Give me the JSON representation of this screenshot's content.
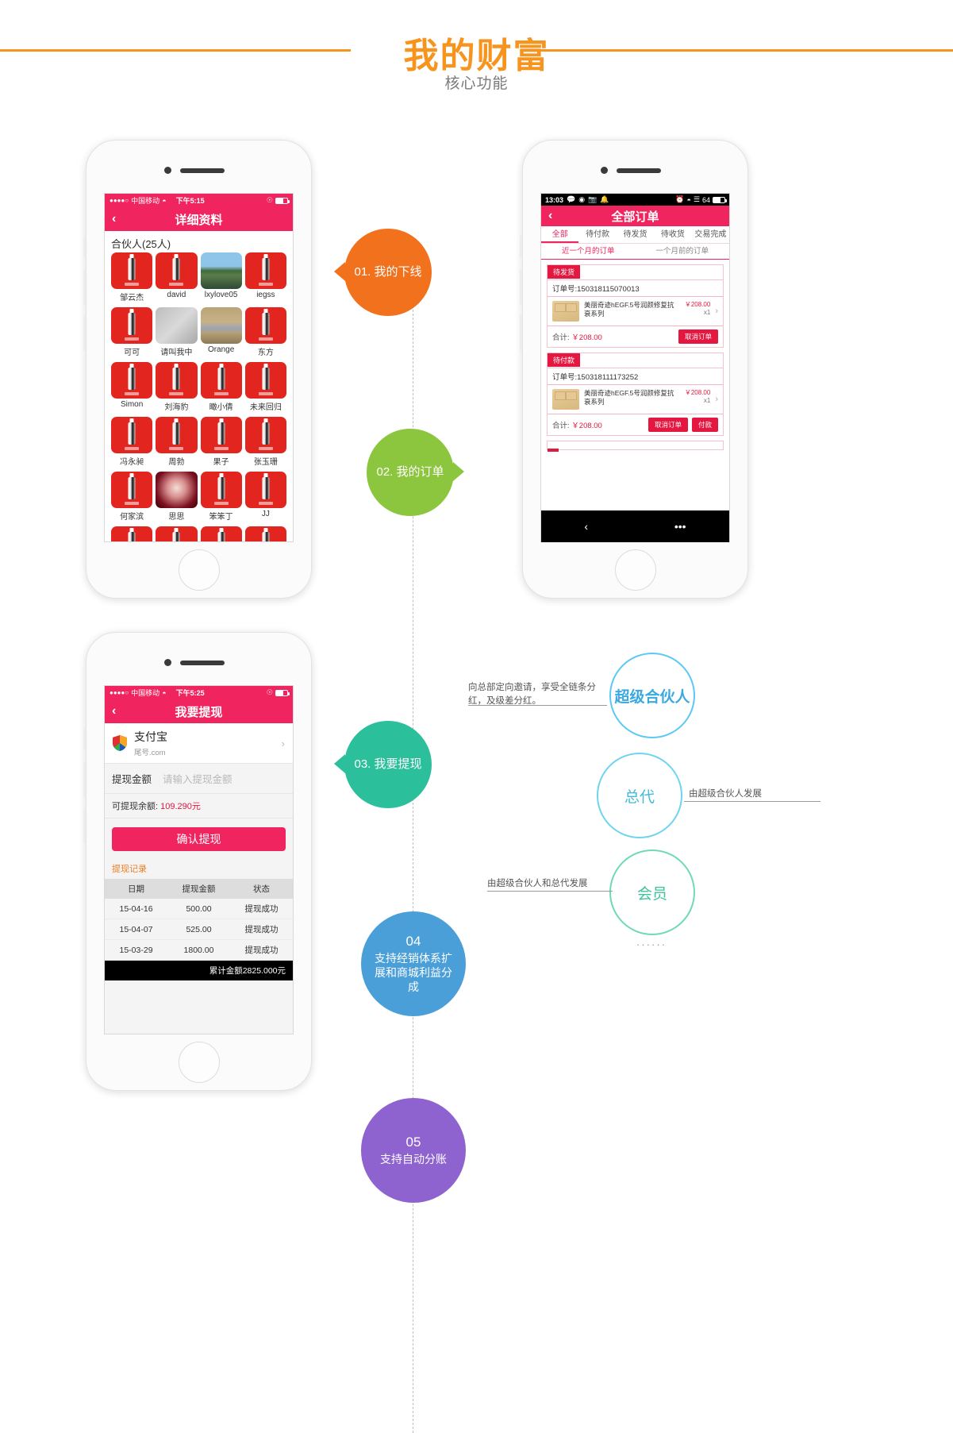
{
  "header": {
    "title": "我的财富",
    "subtitle": "核心功能"
  },
  "phone1": {
    "status": {
      "carrier": "中国移动",
      "dots": "●●●●○",
      "wifi": "ᵛ",
      "time": "下午5:15"
    },
    "nav": {
      "back": "‹",
      "title": "详细资料"
    },
    "section_title": "合伙人(25人)",
    "partners": [
      {
        "name": "邹云杰",
        "avatar": "product"
      },
      {
        "name": "david",
        "avatar": "product"
      },
      {
        "name": "lxylove05",
        "avatar": "photo-a"
      },
      {
        "name": "iegss",
        "avatar": "product"
      },
      {
        "name": "可可",
        "avatar": "product"
      },
      {
        "name": "请叫我中",
        "avatar": "photo-b"
      },
      {
        "name": "Orange",
        "avatar": "photo-c"
      },
      {
        "name": "东方",
        "avatar": "product"
      },
      {
        "name": "Simon",
        "avatar": "product"
      },
      {
        "name": "刘海豹",
        "avatar": "product"
      },
      {
        "name": "瞰小倩",
        "avatar": "product"
      },
      {
        "name": "未来回归",
        "avatar": "product"
      },
      {
        "name": "冯永昶",
        "avatar": "product"
      },
      {
        "name": "周勃",
        "avatar": "product"
      },
      {
        "name": "果子",
        "avatar": "product"
      },
      {
        "name": "张玉珊",
        "avatar": "product"
      },
      {
        "name": "何家滨",
        "avatar": "product"
      },
      {
        "name": "思思",
        "avatar": "photo-d"
      },
      {
        "name": "笨笨丁",
        "avatar": "product"
      },
      {
        "name": "JJ",
        "avatar": "product"
      },
      {
        "name": "",
        "avatar": "product"
      },
      {
        "name": "",
        "avatar": "product"
      },
      {
        "name": "",
        "avatar": "product"
      },
      {
        "name": "",
        "avatar": "product"
      }
    ]
  },
  "phone2": {
    "status": {
      "time": "13:03",
      "icons": [
        "message-icon",
        "link-icon",
        "photo-icon",
        "bell-icon"
      ],
      "right_icons": [
        "alarm-icon",
        "wifi-icon",
        "signal-icon"
      ],
      "battery": "64"
    },
    "nav": {
      "back": "‹",
      "title": "全部订单"
    },
    "tabs": [
      {
        "label": "全部",
        "active": true
      },
      {
        "label": "待付款",
        "active": false
      },
      {
        "label": "待发货",
        "active": false
      },
      {
        "label": "待收货",
        "active": false
      },
      {
        "label": "交易完成",
        "active": false
      }
    ],
    "subtabs": [
      {
        "label": "近一个月的订单",
        "active": true
      },
      {
        "label": "一个月前的订单",
        "active": false
      }
    ],
    "orders": [
      {
        "status_tag": "待发货",
        "order_no_label": "订单号:150318115070013",
        "product_name": "美丽奇迹hEGF.5号润颜修复抗衰系列",
        "price": "￥208.00",
        "qty": "x1",
        "arrow": "›",
        "total_label": "合计:",
        "total_amount": "￥208.00",
        "buttons": [
          "取消订单"
        ]
      },
      {
        "status_tag": "待付款",
        "order_no_label": "订单号:150318111173252",
        "product_name": "美丽奇迹hEGF.5号润颜修复抗衰系列",
        "price": "￥208.00",
        "qty": "x1",
        "arrow": "›",
        "total_label": "合计:",
        "total_amount": "￥208.00",
        "buttons": [
          "取消订单",
          "付款"
        ]
      }
    ],
    "navbar": {
      "back": "‹",
      "more": "•••"
    }
  },
  "phone3": {
    "status": {
      "carrier": "中国移动",
      "dots": "●●●●○",
      "wifi": "ᵛ",
      "time": "下午5:25"
    },
    "nav": {
      "back": "‹",
      "title": "我要提现"
    },
    "account": {
      "name": "支付宝",
      "sub": "尾号.com",
      "chevron": "›",
      "icon": "alipay-shield-icon"
    },
    "amount_field": {
      "label": "提现金额",
      "placeholder": "请输入提现金额",
      "value": ""
    },
    "balance": {
      "label": "可提现余额:",
      "value": "109.290元"
    },
    "confirm_button": "确认提现",
    "records_title": "提现记录",
    "records_columns": [
      "日期",
      "提现金额",
      "状态"
    ],
    "records": [
      [
        "15-04-16",
        "500.00",
        "提现成功"
      ],
      [
        "15-04-07",
        "525.00",
        "提现成功"
      ],
      [
        "15-03-29",
        "1800.00",
        "提现成功"
      ]
    ],
    "total_row": "累计金额2825.000元"
  },
  "steps": [
    {
      "id": "01",
      "label": "01. 我的下线",
      "color": "#f2711c"
    },
    {
      "id": "02",
      "label": "02. 我的订单",
      "color": "#8cc63f"
    },
    {
      "id": "03",
      "label": "03. 我要提现",
      "color": "#2bbf9b"
    },
    {
      "id": "04",
      "num": "04",
      "label": "支持经销体系扩展和商城利益分成",
      "color": "#4a9fd8"
    },
    {
      "id": "05",
      "num": "05",
      "label": "支持自动分账",
      "color": "#8e63d0"
    }
  ],
  "hierarchy": {
    "nodes": [
      {
        "label": "超级合伙人",
        "note": "向总部定向邀请，享受全链条分红，及级差分红。",
        "color": "#5bc8f5"
      },
      {
        "label": "总代",
        "note": "由超级合伙人发展",
        "color": "#6fd4ef"
      },
      {
        "label": "会员",
        "note": "由超级合伙人和总代发展",
        "color": "#6fd9b8"
      }
    ],
    "ellipsis": "······"
  }
}
